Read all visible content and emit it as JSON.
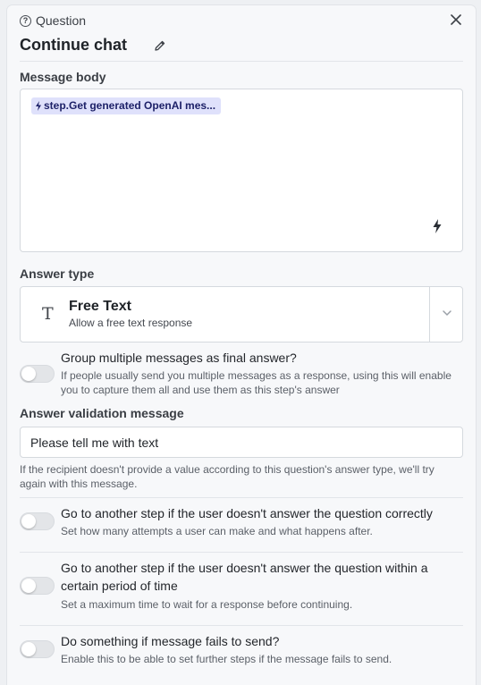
{
  "header": {
    "node_type": "Question",
    "title": "Continue chat"
  },
  "message_body": {
    "label": "Message body",
    "chip_text": "step.Get generated OpenAI mes..."
  },
  "answer_type": {
    "label": "Answer type",
    "selected_title": "Free Text",
    "selected_description": "Allow a free text response"
  },
  "options": {
    "group_messages": {
      "title": "Group multiple messages as final answer?",
      "description": "If people usually send you multiple messages as a response, using this will enable you to capture them all and use them as this step's answer",
      "enabled": false
    },
    "wrong_answer": {
      "title": "Go to another step if the user doesn't answer the question correctly",
      "description": "Set how many attempts a user can make and what happens after.",
      "enabled": false
    },
    "timeout": {
      "title": "Go to another step if the user doesn't answer the question within a certain period of time",
      "description": "Set a maximum time to wait for a response before continuing.",
      "enabled": false
    },
    "send_failure": {
      "title": "Do something if message fails to send?",
      "description": "Enable this to be able to set further steps if the message fails to send.",
      "enabled": false
    }
  },
  "validation": {
    "label": "Answer validation message",
    "value": "Please tell me with text",
    "help": "If the recipient doesn't provide a value according to this question's answer type, we'll try again with this message."
  },
  "colors": {
    "chip_bg": "#dfe1fb",
    "chip_text": "#1d2168",
    "panel_bg": "#f7f8fa"
  }
}
